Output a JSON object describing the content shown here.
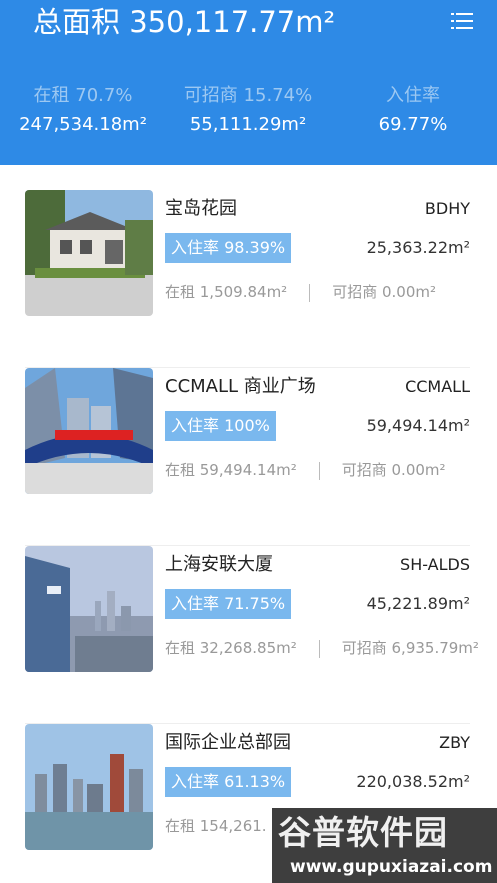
{
  "header": {
    "total_area": "总面积 350,117.77m²",
    "stats": [
      {
        "label": "在租 70.7%",
        "value": "247,534.18m²"
      },
      {
        "label": "可招商 15.74%",
        "value": "55,111.29m²"
      },
      {
        "label": "入住率",
        "value": "69.77%"
      }
    ],
    "menu_icon": "list-icon"
  },
  "properties": [
    {
      "name": "宝岛花园",
      "code": "BDHY",
      "occupancy": "入住率 98.39%",
      "area": "25,363.22m²",
      "leased": "在租 1,509.84m²",
      "available": "可招商 0.00m²",
      "image": "villa-photo"
    },
    {
      "name": "CCMALL 商业广场",
      "code": "CCMALL",
      "occupancy": "入住率 100%",
      "area": "59,494.14m²",
      "leased": "在租 59,494.14m²",
      "available": "可招商 0.00m²",
      "image": "mall-photo"
    },
    {
      "name": "上海安联大厦",
      "code": "SH-ALDS",
      "occupancy": "入住率 71.75%",
      "area": "45,221.89m²",
      "leased": "在租 32,268.85m²",
      "available": "可招商 6,935.79m²",
      "image": "tower-photo"
    },
    {
      "name": "国际企业总部园",
      "code": "ZBY",
      "occupancy": "入住率 61.13%",
      "area": "220,038.52m²",
      "leased": "在租 154,261.",
      "available": "",
      "image": "skyline-photo"
    }
  ],
  "watermark": {
    "title": "谷普软件园",
    "url": "www.gupuxiazai.com"
  },
  "colors": {
    "header_bg": "#2e8ae6",
    "badge_bg": "#7ab8ee",
    "stat_label": "#9cc8f2"
  }
}
